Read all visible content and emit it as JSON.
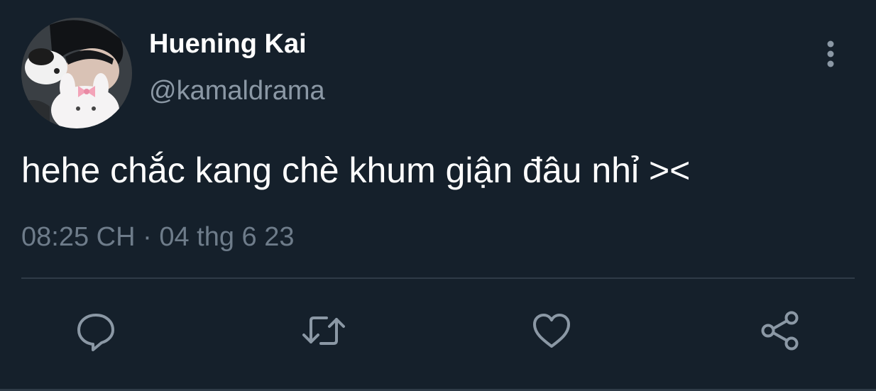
{
  "tweet": {
    "author": {
      "display_name": "Huening Kai",
      "handle": "@kamaldrama",
      "avatar_icon": "profile-photo"
    },
    "text": "hehe chắc kang chè khum giận đâu nhỉ ><",
    "time": "08:25 CH",
    "separator": "·",
    "date": "04 thg 6 23"
  },
  "actions": [
    {
      "name": "reply",
      "icon": "comment-icon"
    },
    {
      "name": "retweet",
      "icon": "retweet-icon"
    },
    {
      "name": "like",
      "icon": "heart-icon"
    },
    {
      "name": "share",
      "icon": "share-icon"
    }
  ],
  "menu": {
    "icon": "more-vertical-icon"
  },
  "colors": {
    "background": "#15202b",
    "primary_text": "#ffffff",
    "secondary_text": "#8b98a5",
    "timestamp_text": "#6e7c8a",
    "icon": "#8b98a5",
    "divider": "#2f3b47"
  }
}
